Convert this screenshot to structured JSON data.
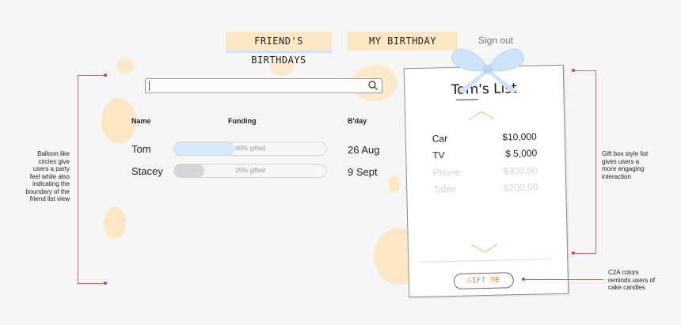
{
  "nav": {
    "tabs": [
      {
        "label": "FRIEND'S BIRTHDAYS",
        "active": true
      },
      {
        "label": "MY BIRTHDAY",
        "active": false
      }
    ],
    "sign_out": "Sign out"
  },
  "search": {
    "placeholder": "",
    "value": ""
  },
  "friends": {
    "headers": {
      "name": "Name",
      "funding": "Funding",
      "bday": "B'day"
    },
    "rows": [
      {
        "name": "Tom",
        "funding_text": "40% gifted",
        "funding_fraction": 0.4,
        "bday": "26 Aug"
      },
      {
        "name": "Stacey",
        "funding_text": "20% gifted",
        "funding_fraction": 0.2,
        "bday": "9 Sept"
      }
    ]
  },
  "card": {
    "title": "Tom's List",
    "items": [
      {
        "name": "Car",
        "price": "$10,000"
      },
      {
        "name": "TV",
        "price": "$ 5,000"
      },
      {
        "name": "Phone",
        "price": "$300.00"
      },
      {
        "name": "Table",
        "price": "$200.00"
      }
    ],
    "gift_button_letters": [
      "G",
      "I",
      "F",
      "T",
      " ",
      "M",
      "E"
    ]
  },
  "annotations": {
    "balloon_note": "Balloon like circles give users a party feel while also indicating the boundary of the friend list view",
    "giftbox_note": "Gift box style list gives users a more engaging interaction",
    "c2a_note": "C2A colors reminds users of cake candles"
  },
  "colors": {
    "balloon": "#fde8c5",
    "nav_tab": "#fde8c5",
    "accent_blue": "#cfe4fb",
    "annotation": "#d94060",
    "chevron": "#f0c98a",
    "bar_fill_tom": "#d8e9fb",
    "bar_fill_stacey": "#d6d6d6",
    "candle_colors": [
      "#f4b400",
      "#e06070",
      "#5aa0e0",
      "#5cb85c"
    ]
  }
}
